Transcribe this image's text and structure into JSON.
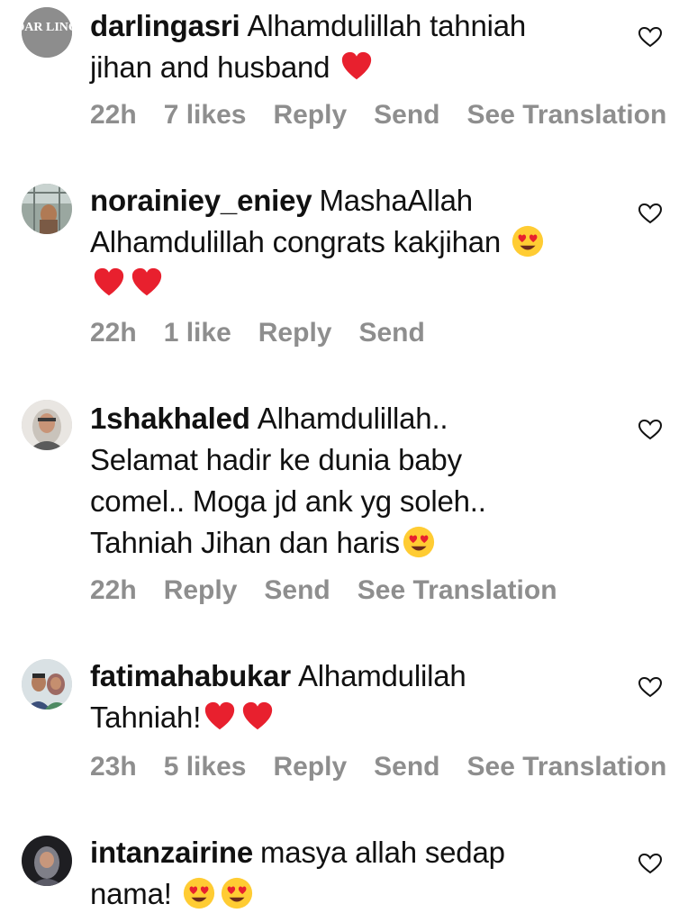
{
  "comments": [
    {
      "username": "darlingasri",
      "text": "Alhamdulillah tahniah jihan and husband",
      "emojis": [
        "red-heart"
      ],
      "time": "22h",
      "likes": "7 likes",
      "reply": "Reply",
      "send": "Send",
      "translate": "See Translation",
      "avatar_text": "DAR LING"
    },
    {
      "username": "norainiey_eniey",
      "text": "MashaAllah Alhamdulillah congrats kakjihan",
      "emojis": [
        "heart-eyes",
        "red-heart",
        "red-heart"
      ],
      "time": "22h",
      "likes": "1 like",
      "reply": "Reply",
      "send": "Send"
    },
    {
      "username": "1shakhaled",
      "text": "Alhamdulillah.. Selamat hadir ke dunia baby comel.. Moga jd ank yg soleh.. Tahniah Jihan dan haris",
      "emojis": [
        "heart-eyes"
      ],
      "time": "22h",
      "reply": "Reply",
      "send": "Send",
      "translate": "See Translation"
    },
    {
      "username": "fatimahabukar",
      "text": "Alhamdulilah Tahniah!",
      "emojis": [
        "red-heart",
        "red-heart"
      ],
      "time": "23h",
      "likes": "5 likes",
      "reply": "Reply",
      "send": "Send",
      "translate": "See Translation"
    },
    {
      "username": "intanzairine",
      "text": "masya allah sedap nama!",
      "emojis": [
        "heart-eyes",
        "heart-eyes"
      ]
    }
  ],
  "colors": {
    "text": "#111111",
    "meta": "#8e8e8e",
    "heart": "#e8202e",
    "emoji_face": "#ffcc33"
  }
}
